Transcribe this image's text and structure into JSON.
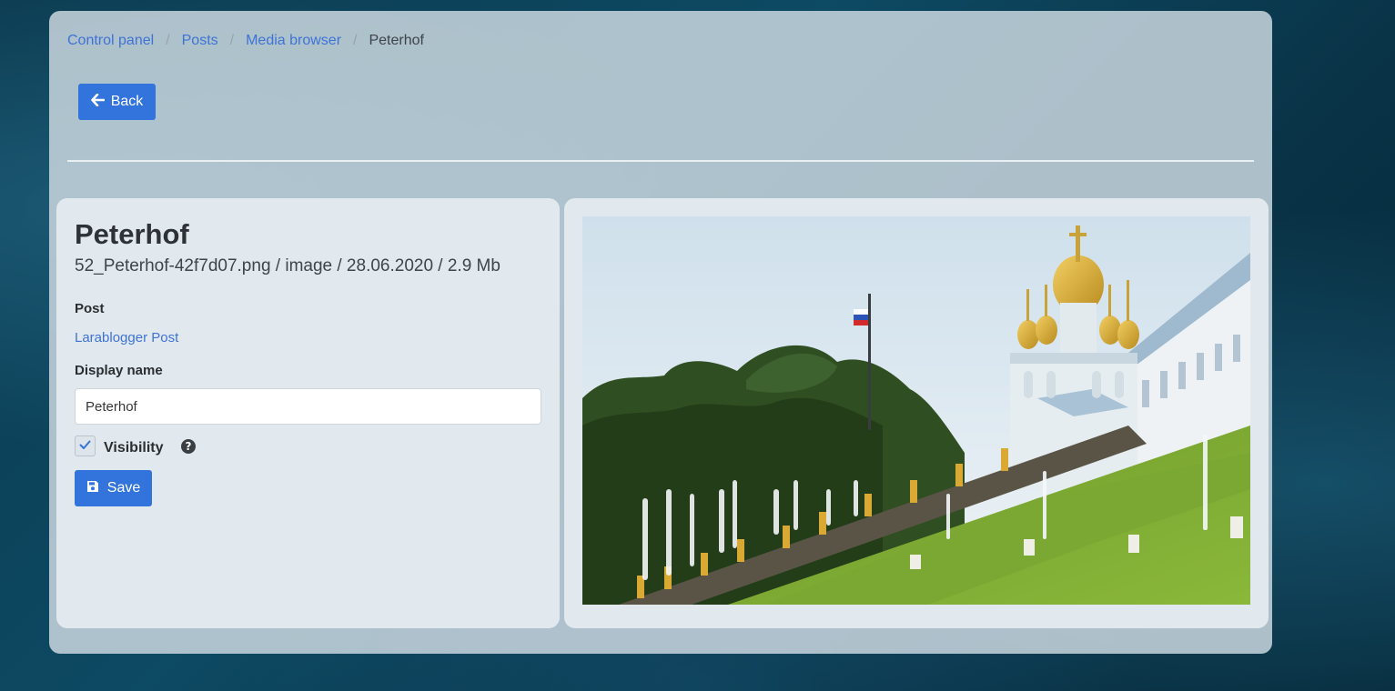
{
  "breadcrumb": {
    "items": [
      "Control panel",
      "Posts",
      "Media browser"
    ],
    "current": "Peterhof",
    "separator": "/"
  },
  "back_button": {
    "label": "Back",
    "icon": "arrow-left-icon"
  },
  "media": {
    "title": "Peterhof",
    "meta": "52_Peterhof-42f7d07.png / image / 28.06.2020 / 2.9 Mb"
  },
  "form": {
    "post_label": "Post",
    "post_link": "Larablogger Post",
    "display_name_label": "Display name",
    "display_name_value": "Peterhof",
    "visibility_label": "Visibility",
    "visibility_checked": true,
    "help_icon": "question-circle-icon",
    "save_label": "Save",
    "save_icon": "floppy-disk-icon"
  },
  "colors": {
    "accent": "#3273dc",
    "link": "#3e73d6"
  }
}
